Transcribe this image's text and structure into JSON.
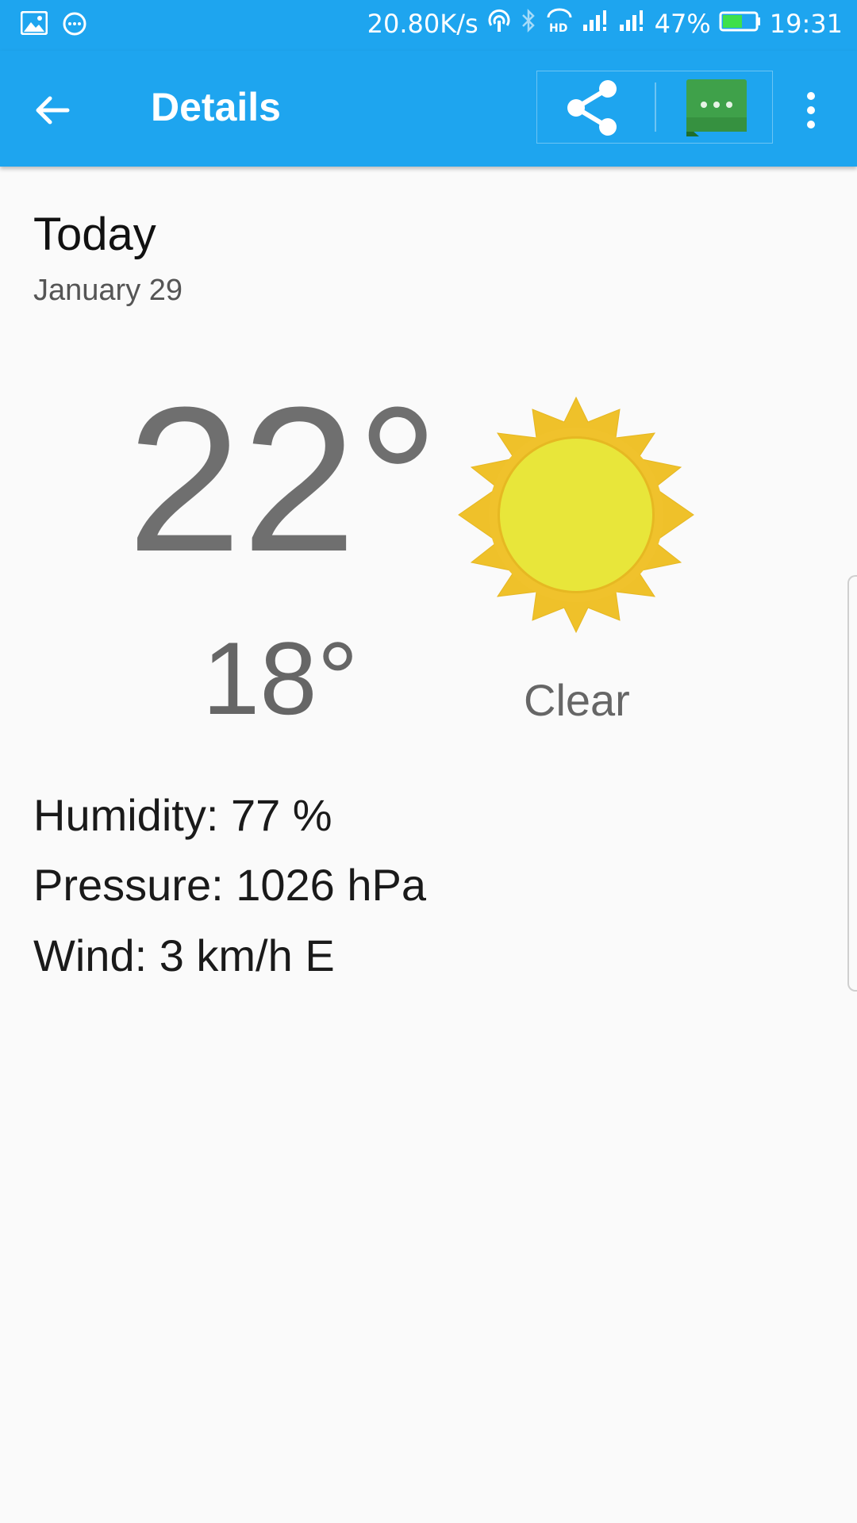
{
  "status_bar": {
    "network_speed": "20.80K/s",
    "battery": "47%",
    "time": "19:31",
    "icons": [
      "gallery-icon",
      "chat-bubble-icon",
      "hotspot-icon",
      "bluetooth-icon",
      "hd-call-icon",
      "signal-icon",
      "signal-icon",
      "battery-icon"
    ]
  },
  "app_bar": {
    "title": "Details",
    "actions": [
      "back-arrow-icon",
      "share-icon",
      "hangouts-message-icon",
      "more-vertical-icon"
    ]
  },
  "forecast": {
    "day": "Today",
    "date": "January 29",
    "high": "22°",
    "low": "18°",
    "condition": "Clear",
    "condition_icon": "sun-icon"
  },
  "details": {
    "humidity": "Humidity: 77 %",
    "pressure": "Pressure: 1026 hPa",
    "wind": "Wind: 3 km/h E"
  },
  "colors": {
    "primary": "#1ea5ef",
    "background": "#fafafa",
    "sun_outer": "#efc12a",
    "sun_inner": "#e8e63a",
    "message_green": "#3fa14a"
  }
}
